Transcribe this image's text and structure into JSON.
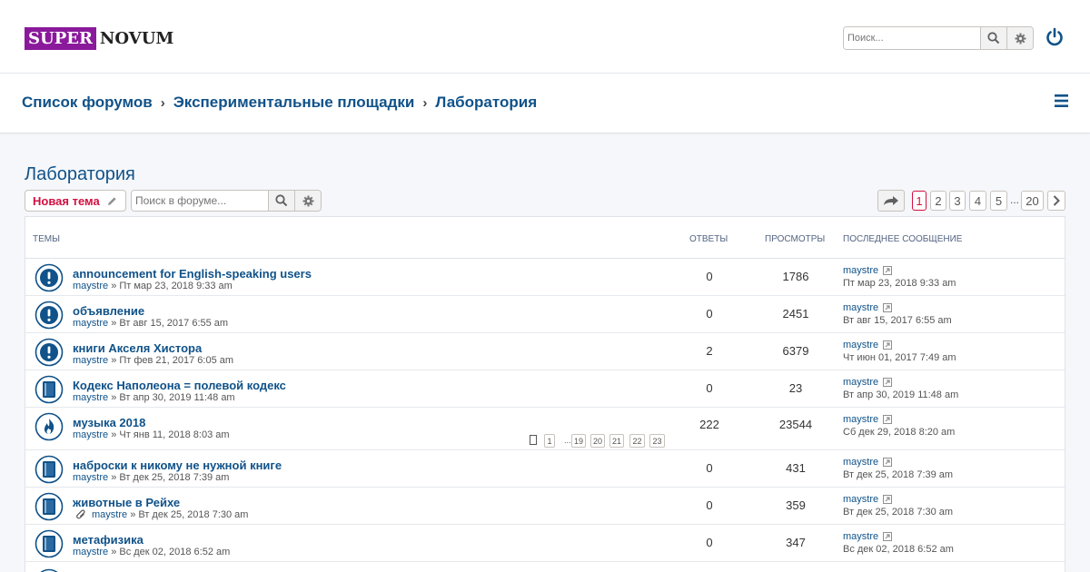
{
  "logo": {
    "part1": "SUPER",
    "part2": "NOVUM"
  },
  "header": {
    "search_placeholder": "Поиск..."
  },
  "breadcrumb": {
    "items": [
      "Список форумов",
      "Экспериментальные площадки",
      "Лаборатория"
    ],
    "separator": "›"
  },
  "page": {
    "title": "Лаборатория"
  },
  "actions": {
    "new_topic": "Новая тема",
    "forum_search_placeholder": "Поиск в форуме..."
  },
  "pagination": {
    "pages": [
      "1",
      "2",
      "3",
      "4",
      "5"
    ],
    "ellipsis": "...",
    "last": "20",
    "current": "1"
  },
  "columns": {
    "topics": "ТЕМЫ",
    "replies": "ОТВЕТЫ",
    "views": "ПРОСМОТРЫ",
    "last_post": "ПОСЛЕДНЕЕ СООБЩЕНИЕ"
  },
  "topics": [
    {
      "title": "announcement for English-speaking users",
      "author": "maystre",
      "date": "» Пт мар 23, 2018 9:33 am",
      "replies": "0",
      "views": "1786",
      "last_author": "maystre",
      "last_date": "Пт мар 23, 2018 9:33 am",
      "icon": "announcement-icon"
    },
    {
      "title": "объявление",
      "author": "maystre",
      "date": "» Вт авг 15, 2017 6:55 am",
      "replies": "0",
      "views": "2451",
      "last_author": "maystre",
      "last_date": "Вт авг 15, 2017 6:55 am",
      "icon": "announcement-icon"
    },
    {
      "title": "книги Акселя Хистора",
      "author": "maystre",
      "date": "» Пт фев 21, 2017 6:05 am",
      "replies": "2",
      "views": "6379",
      "last_author": "maystre",
      "last_date": "Чт июн 01, 2017 7:49 am",
      "icon": "announcement-icon"
    },
    {
      "title": "Кодекс Наполеона = полевой кодекс",
      "author": "maystre",
      "date": "» Вт апр 30, 2019 11:48 am",
      "replies": "0",
      "views": "23",
      "last_author": "maystre",
      "last_date": "Вт апр 30, 2019 11:48 am",
      "icon": "topic-icon"
    },
    {
      "title": "музыка 2018",
      "author": "maystre",
      "date": "» Чт янв 11, 2018 8:03 am",
      "replies": "222",
      "views": "23544",
      "last_author": "maystre",
      "last_date": "Сб дек 29, 2018 8:20 am",
      "icon": "hot-topic-icon",
      "pages": [
        "1",
        "...",
        "19",
        "20",
        "21",
        "22",
        "23"
      ]
    },
    {
      "title": "наброски к никому не нужной книге",
      "author": "maystre",
      "date": "» Вт дек 25, 2018 7:39 am",
      "replies": "0",
      "views": "431",
      "last_author": "maystre",
      "last_date": "Вт дек 25, 2018 7:39 am",
      "icon": "topic-icon"
    },
    {
      "title": "животные в Рейхе",
      "author": "maystre",
      "date": "» Вт дек 25, 2018 7:30 am",
      "replies": "0",
      "views": "359",
      "last_author": "maystre",
      "last_date": "Вт дек 25, 2018 7:30 am",
      "icon": "topic-icon",
      "attachment": true
    },
    {
      "title": "метафизика",
      "author": "maystre",
      "date": "» Вс дек 02, 2018 6:52 am",
      "replies": "0",
      "views": "347",
      "last_author": "maystre",
      "last_date": "Вс дек 02, 2018 6:52 am",
      "icon": "topic-icon"
    }
  ]
}
